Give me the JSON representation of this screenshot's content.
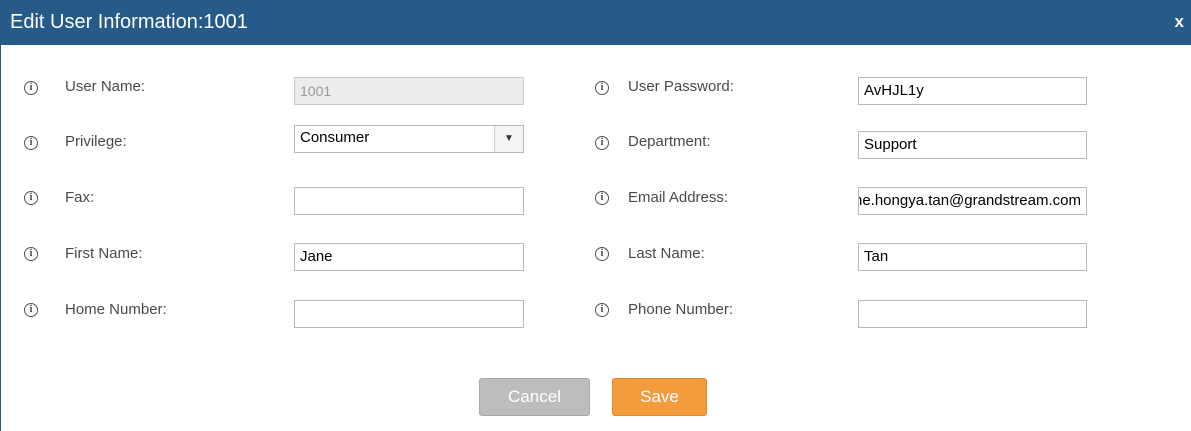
{
  "dialog": {
    "title": "Edit User Information:1001",
    "close_label": "x"
  },
  "icons": {
    "info": "info-circle-icon",
    "close": "close-icon",
    "dropdown": "chevron-down-icon"
  },
  "left": {
    "user_name": {
      "label": "User Name:",
      "value": "1001"
    },
    "privilege": {
      "label": "Privilege:",
      "value": "Consumer",
      "arrow": "▼"
    },
    "fax": {
      "label": "Fax:",
      "value": ""
    },
    "first_name": {
      "label": "First Name:",
      "value": "Jane"
    },
    "home_number": {
      "label": "Home Number:",
      "value": ""
    }
  },
  "right": {
    "user_password": {
      "label": "User Password:",
      "value": "AvHJL1y"
    },
    "department": {
      "label": "Department:",
      "value": "Support"
    },
    "email": {
      "label": "Email Address:",
      "value": "jane.hongya.tan@grandstream.com"
    },
    "last_name": {
      "label": "Last Name:",
      "value": "Tan"
    },
    "phone_number": {
      "label": "Phone Number:",
      "value": ""
    }
  },
  "buttons": {
    "cancel_label": "Cancel",
    "save_label": "Save"
  },
  "colors": {
    "titlebar": "#265a88",
    "save": "#f39c3b",
    "cancel": "#bdbdbd"
  }
}
